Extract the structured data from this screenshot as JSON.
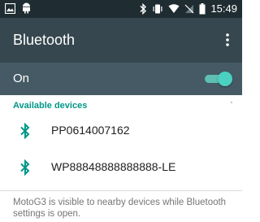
{
  "status_bar": {
    "time": "15:49",
    "icons": [
      "gallery-icon",
      "android-icon",
      "bluetooth-icon",
      "vibrate-icon",
      "wifi-icon",
      "no-signal-icon",
      "battery-icon"
    ]
  },
  "app_bar": {
    "title": "Bluetooth",
    "menu_icon": "more-vert-icon"
  },
  "toggle_row": {
    "label": "On",
    "enabled": true
  },
  "available_devices": {
    "header": "Available devices",
    "items": [
      {
        "name": "PP0614007162",
        "icon": "bluetooth-icon"
      },
      {
        "name": "WP88848888888888-LE",
        "icon": "bluetooth-icon"
      }
    ]
  },
  "footer_note": "MotoG3 is visible to nearby devices while Bluetooth settings is open.",
  "colors": {
    "status_bar_bg": "#1f2d33",
    "app_bar_bg": "#37474f",
    "toggle_row_bg": "#455a64",
    "accent": "#009688"
  }
}
